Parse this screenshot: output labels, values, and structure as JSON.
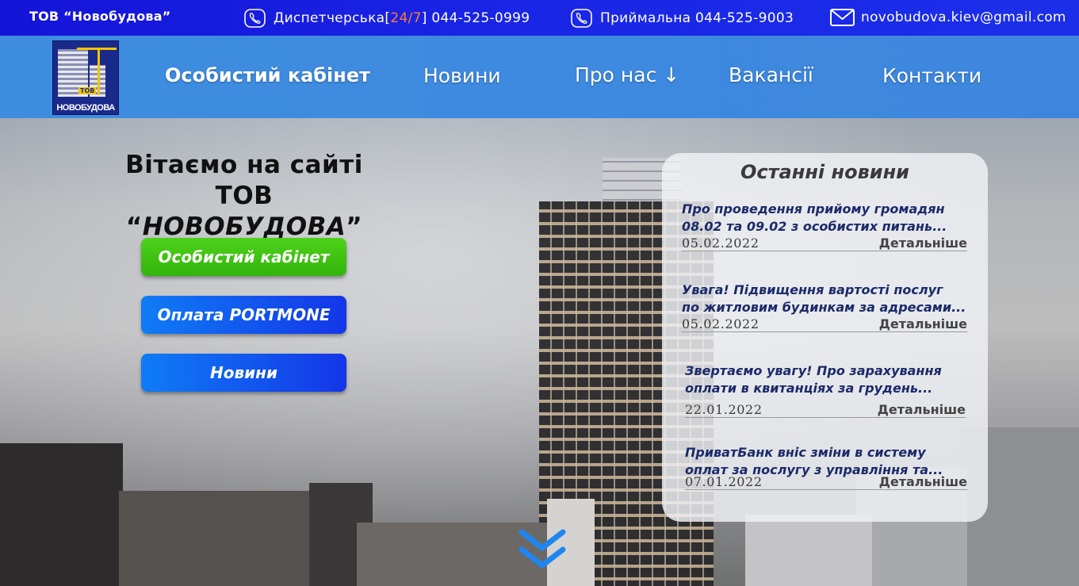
{
  "topbar": {
    "company": "ТОВ “Новобудова”",
    "dispatch_prefix": "Диспетчерська[",
    "dispatch_hours": "24/7",
    "dispatch_suffix": "] 044-525-0999",
    "reception": "Приймальна 044-525-9003",
    "email": "novobudova.kiev@gmail.com",
    "phone_icon": "phone-icon",
    "mail_icon": "mail-icon"
  },
  "logo": {
    "tov": "ТОВ",
    "name": "НОВОБУДОВА"
  },
  "nav": {
    "cabinet": "Особистий кабінет",
    "news": "Новини",
    "about": "Про нас ↓",
    "vacancies": "Вакансії",
    "contacts": "Контакти"
  },
  "hero": {
    "welcome_line1": "Вітаємо на сайті",
    "welcome_line2_prefix": "ТОВ “",
    "welcome_line2_name": "НОВОБУДОВА",
    "welcome_line2_suffix": "”",
    "btn_cabinet": "Особистий кабінет",
    "btn_portmone": "Оплата PORTMONE",
    "btn_news": "Новини"
  },
  "news_panel": {
    "title": "Останні новини",
    "more_label": "Детальніше",
    "items": [
      {
        "line1": "Про проведення прийому громадян",
        "line2": "08.02 та 09.02 з особистих питань...",
        "date": "05.02.2022"
      },
      {
        "line1": "Увага! Підвищення вартості послуг",
        "line2": "по житловим будинкам за адресами...",
        "date": "05.02.2022"
      },
      {
        "line1": "Звертаємо увагу! Про зарахування",
        "line2": "оплати в квитанціях за грудень...",
        "date": "22.01.2022"
      },
      {
        "line1": "ПриватБанк вніс зміни в систему",
        "line2": "оплат за послугу з управління та...",
        "date": "07.01.2022"
      }
    ]
  },
  "colors": {
    "accent_orange": "#ff7a3a",
    "green_button": "#3cc012",
    "blue_button": "#1436e8",
    "nav_bg": "#3f8de0",
    "topbar_bg": "#1a26e6"
  }
}
